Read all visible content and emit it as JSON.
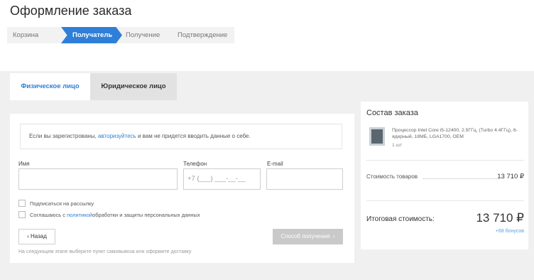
{
  "page": {
    "title": "Оформление заказа"
  },
  "steps": [
    "Корзина",
    "Получатель",
    "Получение",
    "Подтверждение"
  ],
  "tabs": {
    "physical": "Физическое лицо",
    "juridical": "Юридическое лицо"
  },
  "notice": {
    "before": "Если вы зарегистрованы, ",
    "link": "авторизуйтесь",
    "after": " и вам не придется вводить данные о себе."
  },
  "form": {
    "name_label": "Имя",
    "phone_label": "Телефон",
    "phone_placeholder": "+7 (___) ___-__-__",
    "email_label": "E-mail",
    "subscribe_label": "Подписаться на рассылку",
    "consent_before": "Соглашаюсь с ",
    "consent_link": "политикой",
    "consent_after": " обработки и защиты персональных данных",
    "back_label": "Назад",
    "next_label": "Способ получения",
    "hint": "На следующем этапе выберите пункт самовывоза или оформите доставку"
  },
  "order": {
    "title": "Состав заказа",
    "product_name": "Процессор Intel Core i5-12400, 2.5ГГц, (Turbo 4.4ГГц), 6-ядерный, 18МБ, LGA1700, OEM",
    "product_qty": "1 шт",
    "goods_cost_label": "Стоимость товаров",
    "goods_cost_value": "13 710 ₽",
    "total_label": "Итоговая стоимость:",
    "total_value": "13 710 ₽",
    "bonus": "+68 бонусов"
  },
  "colors": {
    "accent": "#2f7fd8",
    "disabled_button": "#c9c9c9",
    "background": "#f0f0f0"
  }
}
